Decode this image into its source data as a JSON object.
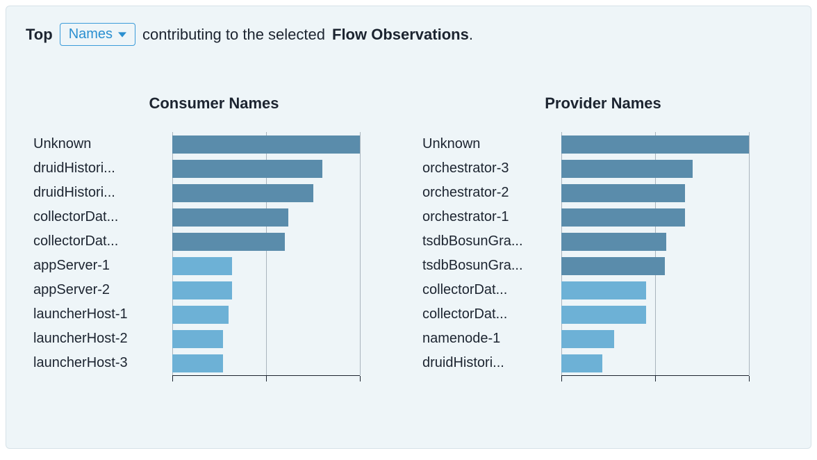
{
  "header": {
    "top": "Top",
    "dropdown_label": "Names",
    "middle": "contributing to the selected",
    "bold_end": "Flow Observations",
    "period": "."
  },
  "chart_data": [
    {
      "type": "bar",
      "orientation": "horizontal",
      "title": "Consumer Names",
      "categories": [
        "Unknown",
        "druidHistori...",
        "druidHistori...",
        "collectorDat...",
        "collectorDat...",
        "appServer-1",
        "appServer-2",
        "launcherHost-1",
        "launcherHost-2",
        "launcherHost-3"
      ],
      "values": [
        100,
        80,
        75,
        62,
        60,
        32,
        32,
        30,
        27,
        27
      ],
      "colors": [
        "#5a8cab",
        "#5a8cab",
        "#5a8cab",
        "#5a8cab",
        "#5a8cab",
        "#6db1d6",
        "#6db1d6",
        "#6db1d6",
        "#6db1d6",
        "#6db1d6"
      ],
      "xlim": [
        0,
        100
      ],
      "grid_ticks": [
        0,
        50,
        100
      ]
    },
    {
      "type": "bar",
      "orientation": "horizontal",
      "title": "Provider Names",
      "categories": [
        "Unknown",
        "orchestrator-3",
        "orchestrator-2",
        "orchestrator-1",
        "tsdbBosunGra...",
        "tsdbBosunGra...",
        "collectorDat...",
        "collectorDat...",
        "namenode-1",
        "druidHistori..."
      ],
      "values": [
        105,
        70,
        66,
        66,
        56,
        55,
        45,
        45,
        28,
        22
      ],
      "colors": [
        "#5a8cab",
        "#5a8cab",
        "#5a8cab",
        "#5a8cab",
        "#5a8cab",
        "#5a8cab",
        "#6db1d6",
        "#6db1d6",
        "#6db1d6",
        "#6db1d6"
      ],
      "xlim": [
        0,
        100
      ],
      "grid_ticks": [
        0,
        50,
        100
      ]
    }
  ]
}
